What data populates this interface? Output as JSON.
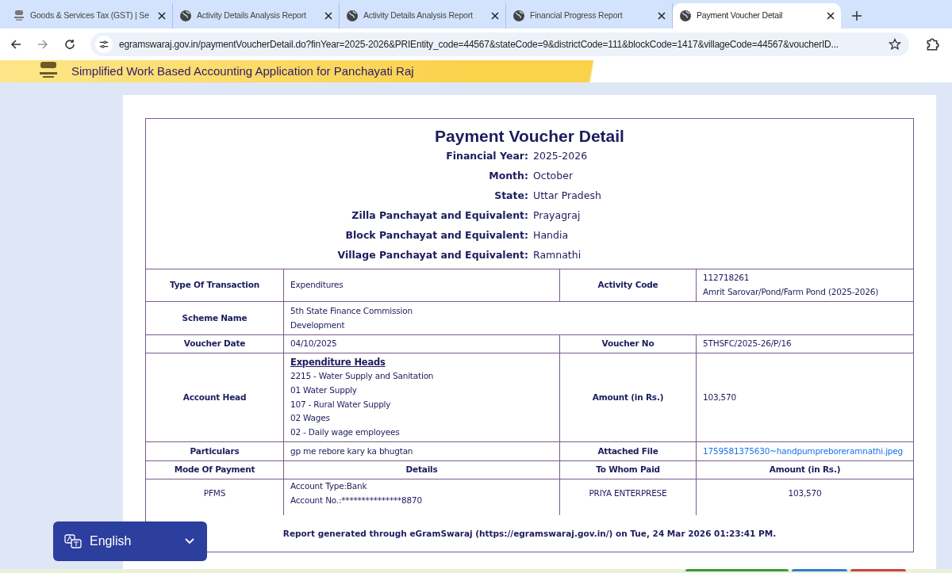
{
  "tabs": [
    {
      "title": "Goods & Services Tax (GST) | Se",
      "selected": false
    },
    {
      "title": "Activity Details Analysis Report",
      "selected": false
    },
    {
      "title": "Activity Details Analysis Report",
      "selected": false
    },
    {
      "title": "Financial Progress Report",
      "selected": false
    },
    {
      "title": "Payment Voucher Detail",
      "selected": true
    }
  ],
  "address_bar": {
    "url": "egramswaraj.gov.in/paymentVoucherDetail.do?finYear=2025-2026&PRIEntity_code=44567&stateCode=9&districtCode=111&blockCode=1417&villageCode=44567&voucherID..."
  },
  "banner": {
    "subtitle": "Simplified Work Based Accounting Application for Panchayati Raj"
  },
  "voucher": {
    "title": "Payment Voucher Detail",
    "header_fields": [
      {
        "label": "Financial Year:",
        "value": "2025-2026"
      },
      {
        "label": "Month:",
        "value": "October"
      },
      {
        "label": "State:",
        "value": "Uttar Pradesh"
      },
      {
        "label": "Zilla Panchayat and Equivalent:",
        "value": "Prayagraj"
      },
      {
        "label": "Block Panchayat and Equivalent:",
        "value": "Handia"
      },
      {
        "label": "Village Panchayat and Equivalent:",
        "value": "Ramnathi"
      }
    ],
    "rows": [
      {
        "cells": [
          {
            "kind": "label",
            "lines": [
              "Type Of Transaction"
            ]
          },
          {
            "kind": "value",
            "lines": [
              "Expenditures"
            ]
          },
          {
            "kind": "label",
            "lines": [
              "Activity Code"
            ]
          },
          {
            "kind": "value",
            "lines": [
              "112718261",
              "Amrit Sarovar/Pond/Farm Pond (2025-2026)"
            ]
          }
        ]
      },
      {
        "cells": [
          {
            "kind": "label",
            "lines": [
              "Scheme Name"
            ]
          },
          {
            "kind": "value",
            "lines": [
              "5th State Finance Commission",
              "Development"
            ]
          }
        ]
      },
      {
        "cells": [
          {
            "kind": "label",
            "lines": [
              "Voucher Date"
            ]
          },
          {
            "kind": "value",
            "lines": [
              "04/10/2025"
            ]
          },
          {
            "kind": "label",
            "lines": [
              "Voucher No"
            ]
          },
          {
            "kind": "value",
            "lines": [
              "5THSFC/2025-26/P/16"
            ]
          }
        ]
      },
      {
        "cells": [
          {
            "kind": "label",
            "lines": [
              "Account Head"
            ]
          },
          {
            "kind": "heads",
            "heading": "Expenditure Heads",
            "lines": [
              "2215 - Water Supply and Sanitation",
              "01 Water Supply",
              "107 - Rural Water Supply",
              "02 Wages",
              "02 - Daily wage employees"
            ]
          },
          {
            "kind": "label",
            "lines": [
              "Amount (in Rs.)"
            ]
          },
          {
            "kind": "value",
            "lines": [
              "103,570"
            ]
          }
        ]
      },
      {
        "cells": [
          {
            "kind": "label",
            "lines": [
              "Particulars"
            ]
          },
          {
            "kind": "value",
            "lines": [
              "gp me rebore kary ka bhugtan"
            ]
          },
          {
            "kind": "label",
            "lines": [
              "Attached File"
            ]
          },
          {
            "kind": "link",
            "lines": [
              "1759581375630~handpumpreboreramnathi.jpeg"
            ]
          }
        ]
      },
      {
        "cells": [
          {
            "kind": "label",
            "lines": [
              "Mode Of Payment"
            ]
          },
          {
            "kind": "label",
            "lines": [
              "Details"
            ]
          },
          {
            "kind": "label",
            "lines": [
              "To Whom Paid"
            ]
          },
          {
            "kind": "label",
            "lines": [
              "Amount (in Rs.)"
            ]
          }
        ]
      },
      {
        "cells": [
          {
            "kind": "center",
            "lines": [
              "PFMS"
            ]
          },
          {
            "kind": "value",
            "lines": [
              "Account Type:Bank",
              "Account No.:***************8870"
            ]
          },
          {
            "kind": "center",
            "lines": [
              "PRIYA ENTERPRESE"
            ]
          },
          {
            "kind": "center",
            "lines": [
              "103,570"
            ]
          }
        ]
      }
    ],
    "footer": "Report generated through eGramSwaraj (https://egramswaraj.gov.in/) on Tue, 24 Mar 2026 01:23:41 PM."
  },
  "language_selector": {
    "label": "English"
  }
}
